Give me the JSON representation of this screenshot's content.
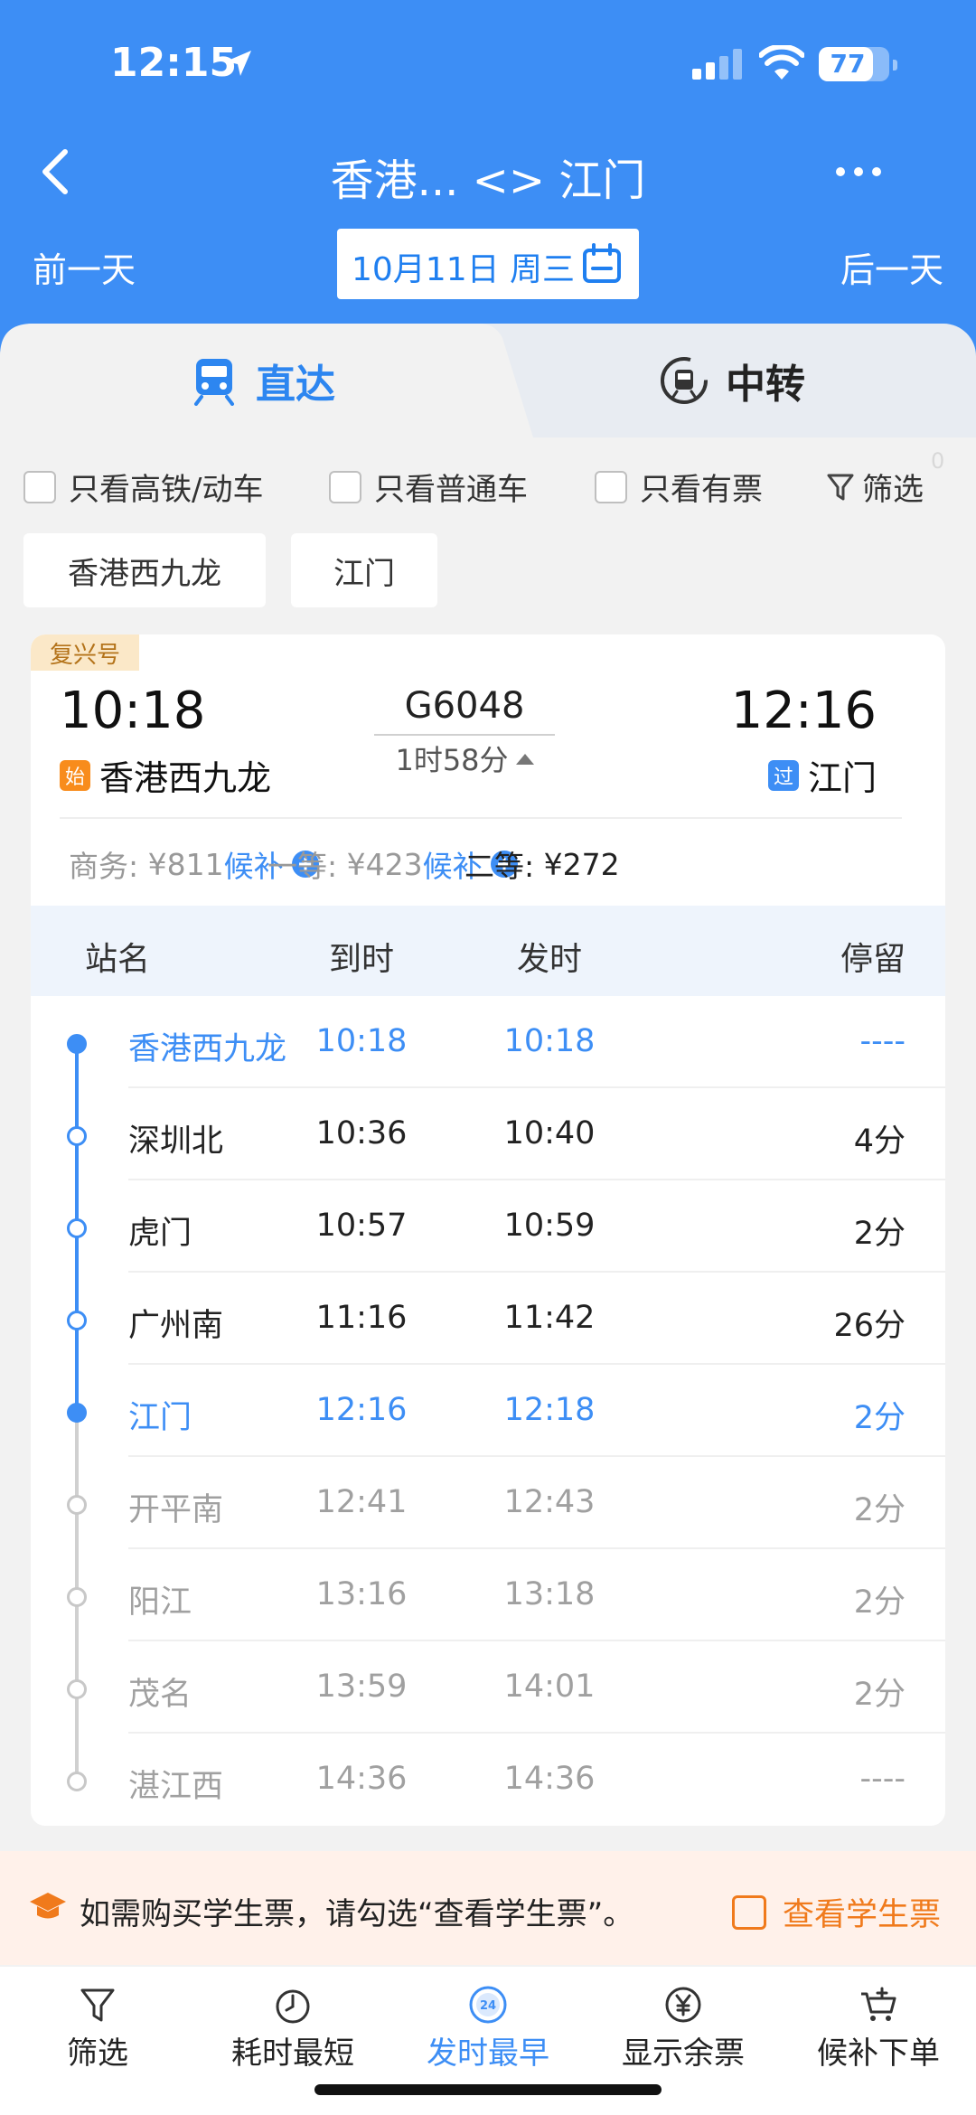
{
  "status_bar": {
    "time": "12:15",
    "battery": "77",
    "battery_level": 0.77
  },
  "nav": {
    "title": "香港... <> 江门"
  },
  "date_bar": {
    "prev": "前一天",
    "date": "10月11日 周三",
    "next": "后一天"
  },
  "tabs": [
    {
      "label": "直达",
      "active": true
    },
    {
      "label": "中转",
      "active": false
    }
  ],
  "filters": {
    "options": [
      "只看高铁/动车",
      "只看普通车",
      "只看有票"
    ],
    "filter_label": "筛选",
    "filter_count": "0"
  },
  "stations": [
    "香港西九龙",
    "江门"
  ],
  "train": {
    "brand": "复兴号",
    "dep_time": "10:18",
    "arr_time": "12:16",
    "number": "G6048",
    "duration": "1时58分",
    "dep_badge": "始",
    "dep_station": "香港西九龙",
    "arr_badge": "过",
    "arr_station": "江门",
    "prices": [
      {
        "cls": "商务:",
        "price": "¥811",
        "status": "候补"
      },
      {
        "cls": "一等:",
        "price": "¥423",
        "status": "候补"
      },
      {
        "cls": "二等:",
        "price": "¥272",
        "status": ""
      }
    ]
  },
  "stops": {
    "headers": [
      "站名",
      "到时",
      "发时",
      "停留"
    ],
    "rows": [
      {
        "name": "香港西九龙",
        "arr": "10:18",
        "dep": "10:18",
        "stay": "----"
      },
      {
        "name": "深圳北",
        "arr": "10:36",
        "dep": "10:40",
        "stay": "4分"
      },
      {
        "name": "虎门",
        "arr": "10:57",
        "dep": "10:59",
        "stay": "2分"
      },
      {
        "name": "广州南",
        "arr": "11:16",
        "dep": "11:42",
        "stay": "26分"
      },
      {
        "name": "江门",
        "arr": "12:16",
        "dep": "12:18",
        "stay": "2分"
      },
      {
        "name": "开平南",
        "arr": "12:41",
        "dep": "12:43",
        "stay": "2分"
      },
      {
        "name": "阳江",
        "arr": "13:16",
        "dep": "13:18",
        "stay": "2分"
      },
      {
        "name": "茂名",
        "arr": "13:59",
        "dep": "14:01",
        "stay": "2分"
      },
      {
        "name": "湛江西",
        "arr": "14:36",
        "dep": "14:36",
        "stay": "----"
      }
    ]
  },
  "student": {
    "notice": "如需购买学生票，请勾选“查看学生票”。",
    "checkbox": "查看学生票"
  },
  "bottom_nav": [
    {
      "label": "筛选",
      "icon": "filter-icon"
    },
    {
      "label": "耗时最短",
      "icon": "timer-icon"
    },
    {
      "label": "发时最早",
      "icon": "clock-24-icon",
      "active": true
    },
    {
      "label": "显示余票",
      "icon": "yen-icon"
    },
    {
      "label": "候补下单",
      "icon": "cart-icon"
    }
  ],
  "colors": {
    "primary": "#3d8ef5",
    "orange": "#f07a1c",
    "brand_tag": "#fbe8c8"
  }
}
